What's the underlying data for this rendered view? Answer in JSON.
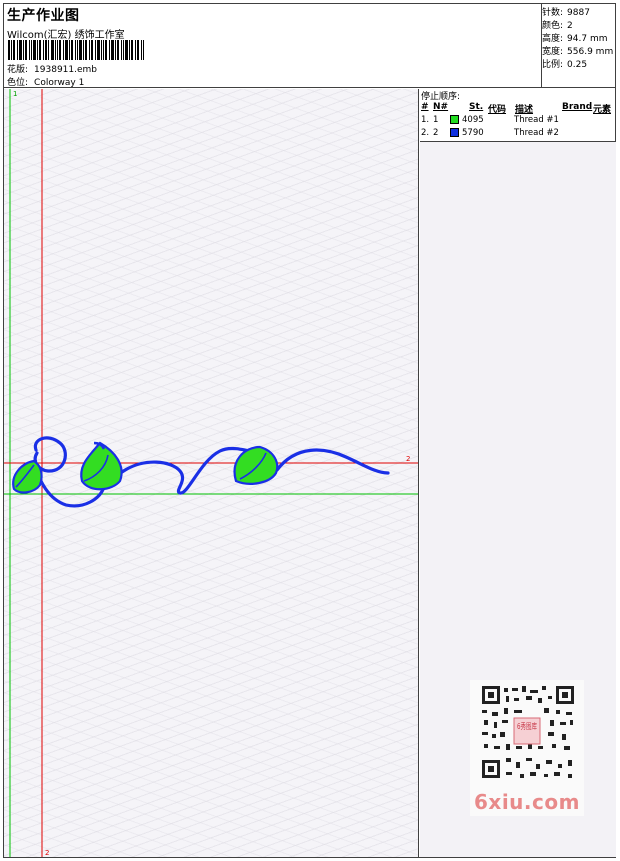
{
  "header": {
    "title": "生产作业图",
    "studio": "Wilcom(汇宏) 绣饰工作室",
    "design": {
      "label": "花版:",
      "value": "1938911.emb"
    },
    "colorway": {
      "label": "色位:",
      "value": "Colorway 1"
    }
  },
  "stats": {
    "stitches": {
      "label": "针数:",
      "value": "9887"
    },
    "colors": {
      "label": "颜色:",
      "value": "2"
    },
    "height": {
      "label": "高度:",
      "value": "94.7 mm"
    },
    "width": {
      "label": "宽度:",
      "value": "556.9 mm"
    },
    "scale": {
      "label": "比例:",
      "value": "0.25"
    }
  },
  "stop_sequence": {
    "heading": "停止顺序:",
    "columns": [
      "#",
      "N#",
      "St.",
      "代码",
      "描述",
      "Brand",
      "元素"
    ],
    "rows": [
      {
        "index": "1.",
        "needle": "1",
        "color": "#22dd22",
        "code": "4095",
        "desc": "Thread #1"
      },
      {
        "index": "2.",
        "needle": "2",
        "color": "#1030e0",
        "code": "5790",
        "desc": "Thread #2"
      }
    ]
  },
  "canvas": {
    "marker_top": "1",
    "marker_right": "2",
    "marker_bottom": "2",
    "guide_colors": {
      "vertical_red": "#e00000",
      "vertical_green": "#00c000",
      "horizontal_red": "#e00000",
      "horizontal_green": "#00c000"
    },
    "stitch_colors": {
      "outline": "#1a2fe6",
      "fill": "#33dd22"
    }
  },
  "watermark": {
    "text": "6xiu.com",
    "qr_badge": "6秀图库"
  }
}
